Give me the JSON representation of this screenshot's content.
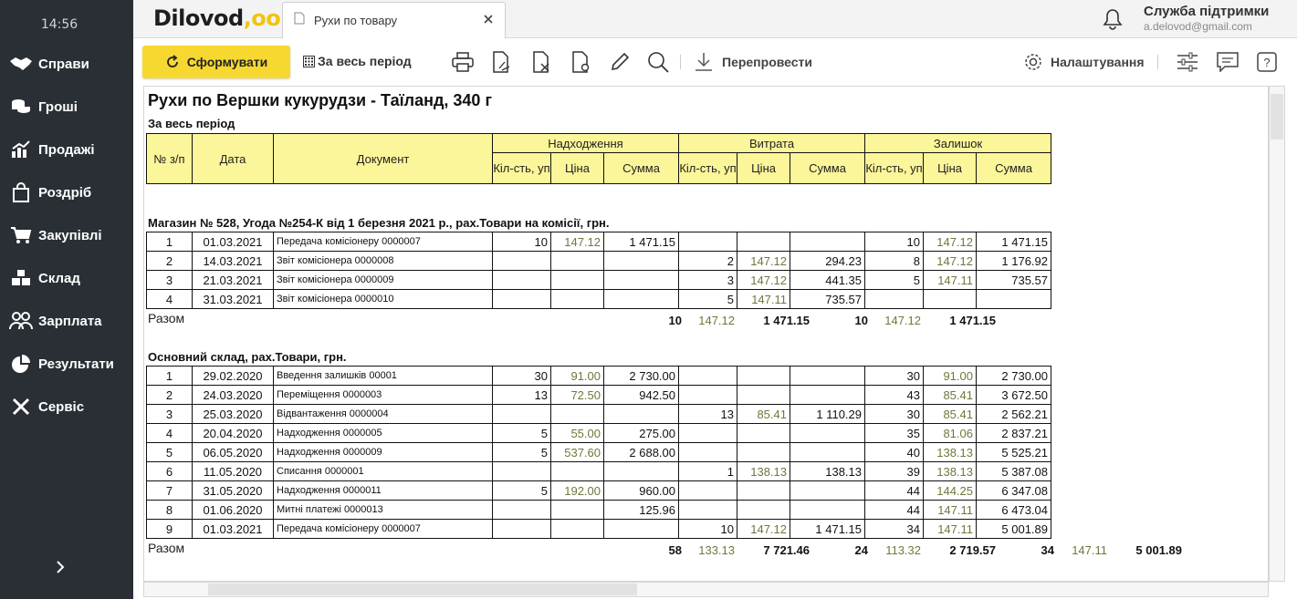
{
  "sidebar": {
    "time": "14:56",
    "items": [
      {
        "label": "Справи",
        "icon": "handshake-icon"
      },
      {
        "label": "Гроші",
        "icon": "coins-icon"
      },
      {
        "label": "Продажі",
        "icon": "chart-bars-icon"
      },
      {
        "label": "Роздріб",
        "icon": "shopping-bag-icon"
      },
      {
        "label": "Закупівлі",
        "icon": "cart-icon"
      },
      {
        "label": "Склад",
        "icon": "boxes-icon"
      },
      {
        "label": "Зарплата",
        "icon": "people-icon"
      },
      {
        "label": "Результати",
        "icon": "pie-chart-icon"
      },
      {
        "label": "Сервіс",
        "icon": "tools-icon"
      }
    ]
  },
  "topbar": {
    "logo": "Dilovod",
    "logo_dots": ",oo",
    "tab_title": "Рухи по товару",
    "support_title": "Служба підтримки",
    "support_email": "a.delovod@gmail.com"
  },
  "toolbar": {
    "form_label": "Сформувати",
    "period_label": "За весь період",
    "repost_label": "Перепровести",
    "settings_label": "Налаштування"
  },
  "report": {
    "title": "Рухи по  Вершки кукурудзи - Таїланд, 340 г",
    "period": "За весь період",
    "headers": {
      "num": "№ з/п",
      "date": "Дата",
      "doc": "Документ",
      "income": "Надходження",
      "expense": "Витрата",
      "balance": "Залишок",
      "qty": "Кіл-сть, уп",
      "price": "Ціна",
      "sum": "Сумма"
    },
    "total_label": "Разом",
    "sections": [
      {
        "name": "Магазин № 528, Угода №254-К від 1 березня 2021 р., рах.Товари на комісії, грн.",
        "rows": [
          [
            "1",
            "01.03.2021",
            "Передача комісіонеру 0000007",
            "10",
            "147.12",
            "1 471.15",
            "",
            "",
            "",
            "10",
            "147.12",
            "1 471.15"
          ],
          [
            "2",
            "14.03.2021",
            "Звіт комісіонера 0000008",
            "",
            "",
            "",
            "2",
            "147.12",
            "294.23",
            "8",
            "147.12",
            "1 176.92"
          ],
          [
            "3",
            "21.03.2021",
            "Звіт комісіонера 0000009",
            "",
            "",
            "",
            "3",
            "147.12",
            "441.35",
            "5",
            "147.11",
            "735.57"
          ],
          [
            "4",
            "31.03.2021",
            "Звіт комісіонера 0000010",
            "",
            "",
            "",
            "5",
            "147.11",
            "735.57",
            "",
            "",
            ""
          ]
        ],
        "totals": [
          "10",
          "147.12",
          "1 471.15",
          "10",
          "147.12",
          "1 471.15",
          "",
          "",
          ""
        ]
      },
      {
        "name": "Основний склад, рах.Товари, грн.",
        "rows": [
          [
            "1",
            "29.02.2020",
            "Введення залишків 00001",
            "30",
            "91.00",
            "2 730.00",
            "",
            "",
            "",
            "30",
            "91.00",
            "2 730.00"
          ],
          [
            "2",
            "24.03.2020",
            "Переміщення 0000003",
            "13",
            "72.50",
            "942.50",
            "",
            "",
            "",
            "43",
            "85.41",
            "3 672.50"
          ],
          [
            "3",
            "25.03.2020",
            "Відвантаження 0000004",
            "",
            "",
            "",
            "13",
            "85.41",
            "1 110.29",
            "30",
            "85.41",
            "2 562.21"
          ],
          [
            "4",
            "20.04.2020",
            "Надходження 0000005",
            "5",
            "55.00",
            "275.00",
            "",
            "",
            "",
            "35",
            "81.06",
            "2 837.21"
          ],
          [
            "5",
            "06.05.2020",
            "Надходження 0000009",
            "5",
            "537.60",
            "2 688.00",
            "",
            "",
            "",
            "40",
            "138.13",
            "5 525.21"
          ],
          [
            "6",
            "11.05.2020",
            "Списання 0000001",
            "",
            "",
            "",
            "1",
            "138.13",
            "138.13",
            "39",
            "138.13",
            "5 387.08"
          ],
          [
            "7",
            "31.05.2020",
            "Надходження 0000011",
            "5",
            "192.00",
            "960.00",
            "",
            "",
            "",
            "44",
            "144.25",
            "6 347.08"
          ],
          [
            "8",
            "01.06.2020",
            "Митні платежі 0000013",
            "",
            "",
            "125.96",
            "",
            "",
            "",
            "44",
            "147.11",
            "6 473.04"
          ],
          [
            "9",
            "01.03.2021",
            "Передача комісіонеру 0000007",
            "",
            "",
            "",
            "10",
            "147.12",
            "1 471.15",
            "34",
            "147.11",
            "5 001.89"
          ]
        ],
        "totals": [
          "58",
          "133.13",
          "7 721.46",
          "24",
          "113.32",
          "2 719.57",
          "34",
          "147.11",
          "5 001.89"
        ]
      }
    ]
  }
}
